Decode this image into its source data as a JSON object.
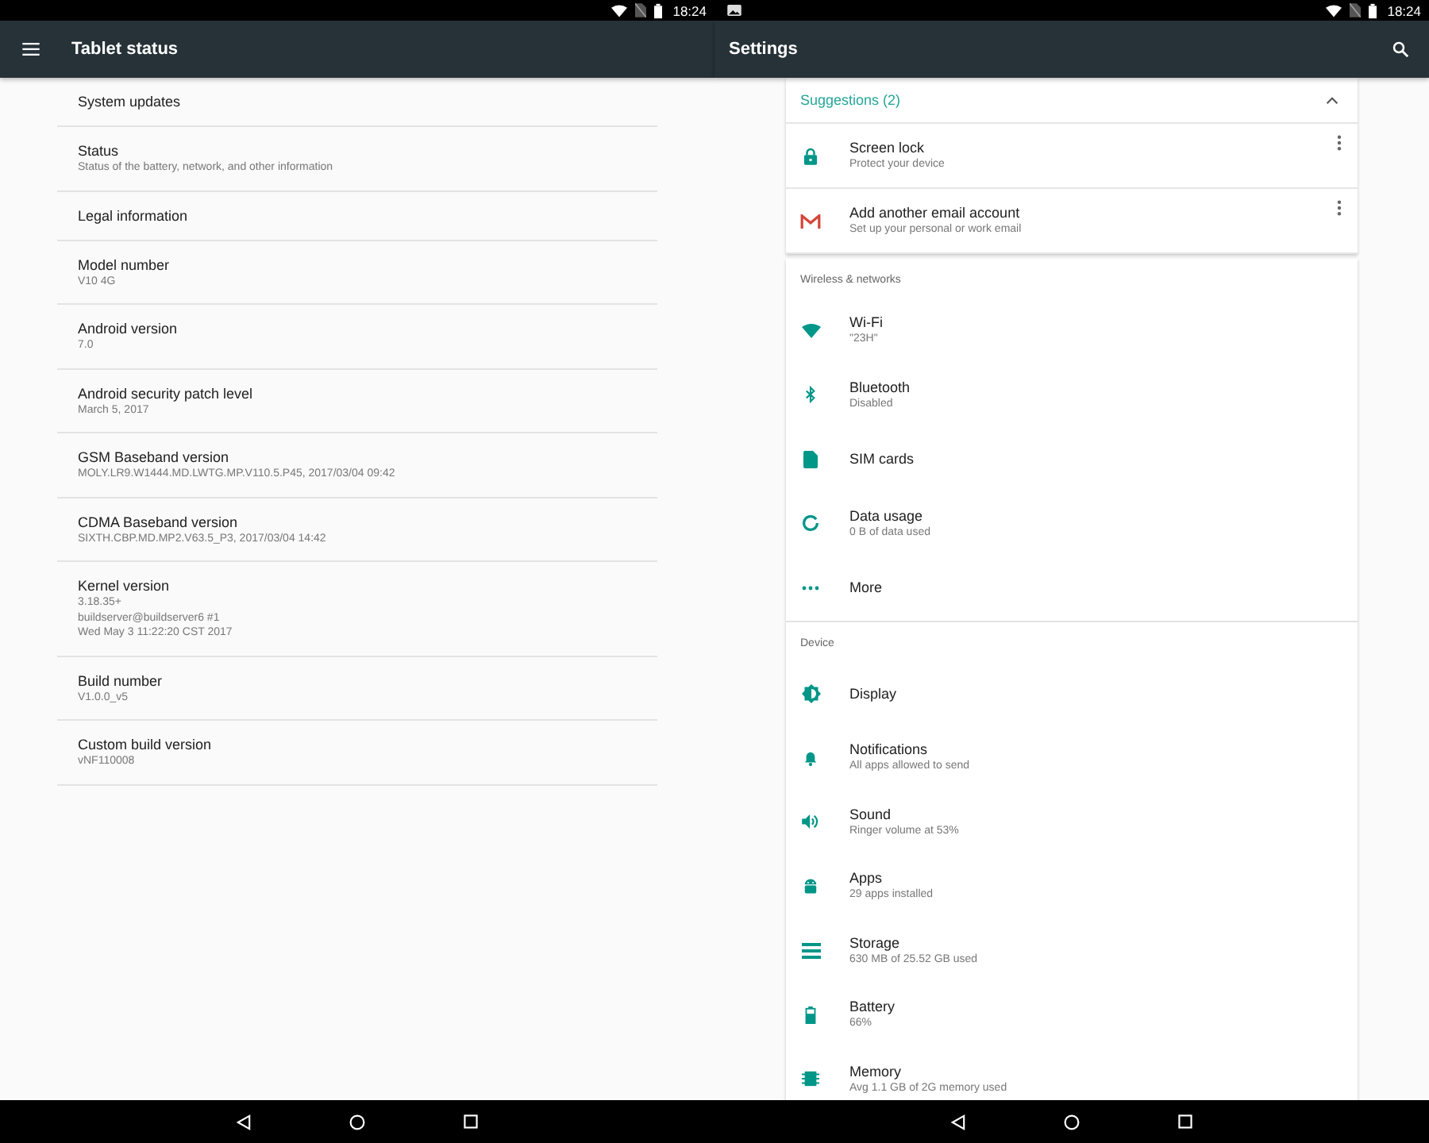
{
  "left_pane": {
    "status_bar": {
      "time": "18:24"
    },
    "title": "Tablet status",
    "items": [
      {
        "title": "System updates"
      },
      {
        "title": "Status",
        "lines": [
          "Status of the battery, network, and other information"
        ]
      },
      {
        "title": "Legal information"
      },
      {
        "title": "Model number",
        "lines": [
          "V10 4G"
        ]
      },
      {
        "title": "Android version",
        "lines": [
          "7.0"
        ]
      },
      {
        "title": "Android security patch level",
        "lines": [
          "March 5, 2017"
        ]
      },
      {
        "title": "GSM Baseband version",
        "lines": [
          "MOLY.LR9.W1444.MD.LWTG.MP.V110.5.P45, 2017/03/04 09:42"
        ]
      },
      {
        "title": "CDMA Baseband version",
        "lines": [
          "SIXTH.CBP.MD.MP2.V63.5_P3, 2017/03/04 14:42"
        ]
      },
      {
        "title": "Kernel version",
        "lines": [
          "3.18.35+",
          "buildserver@buildserver6 #1",
          "Wed May 3 11:22:20 CST 2017"
        ]
      },
      {
        "title": "Build number",
        "lines": [
          "V1.0.0_v5"
        ]
      },
      {
        "title": "Custom build version",
        "lines": [
          "vNF110008"
        ]
      }
    ]
  },
  "right_pane": {
    "status_bar": {
      "time": "18:24"
    },
    "title": "Settings",
    "suggestions": {
      "header": "Suggestions (2)",
      "expanded": true,
      "items": [
        {
          "title": "Screen lock",
          "summary": "Protect your device"
        },
        {
          "title": "Add another email account",
          "summary": "Set up your personal or work email"
        }
      ]
    },
    "sections": [
      {
        "header": "Wireless & networks",
        "items": [
          {
            "title": "Wi-Fi",
            "summary": "\"23H\""
          },
          {
            "title": "Bluetooth",
            "summary": "Disabled"
          },
          {
            "title": "SIM cards"
          },
          {
            "title": "Data usage",
            "summary": "0 B of data used"
          },
          {
            "title": "More"
          }
        ]
      },
      {
        "header": "Device",
        "items": [
          {
            "title": "Display"
          },
          {
            "title": "Notifications",
            "summary": "All apps allowed to send"
          },
          {
            "title": "Sound",
            "summary": "Ringer volume at 53%"
          },
          {
            "title": "Apps",
            "summary": "29 apps installed"
          },
          {
            "title": "Storage",
            "summary": "630 MB of 25.52 GB used"
          },
          {
            "title": "Battery",
            "summary": "66%"
          },
          {
            "title": "Memory",
            "summary": "Avg 1.1 GB of 2G memory used"
          }
        ]
      }
    ]
  }
}
